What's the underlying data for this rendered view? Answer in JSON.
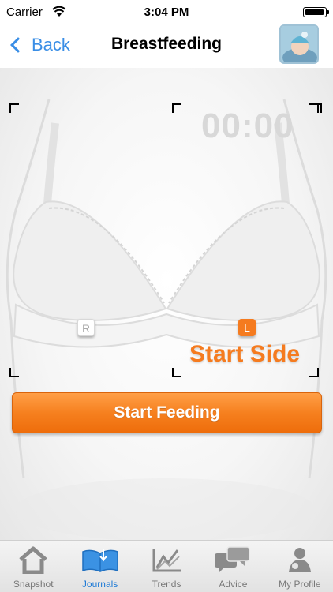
{
  "status_bar": {
    "carrier": "Carrier",
    "time": "3:04 PM",
    "icons": [
      "wifi-icon",
      "battery-icon"
    ]
  },
  "nav": {
    "back_label": "Back",
    "title": "Breastfeeding"
  },
  "timer": {
    "value": "00:00"
  },
  "sides": {
    "right_label": "R",
    "left_label": "L",
    "selected": "L",
    "start_side_label": "Start Side"
  },
  "actions": {
    "start_feeding_label": "Start Feeding"
  },
  "tabs": [
    {
      "label": "Snapshot",
      "icon": "house-icon",
      "active": false
    },
    {
      "label": "Journals",
      "icon": "journal-icon",
      "active": true
    },
    {
      "label": "Trends",
      "icon": "trend-chart-icon",
      "active": false
    },
    {
      "label": "Advice",
      "icon": "chat-bubbles-icon",
      "active": false
    },
    {
      "label": "My Profile",
      "icon": "profile-icon",
      "active": false
    }
  ],
  "colors": {
    "accent": "#f57b1f",
    "link": "#3a8ee6",
    "tab_active": "#1f7bd6"
  }
}
